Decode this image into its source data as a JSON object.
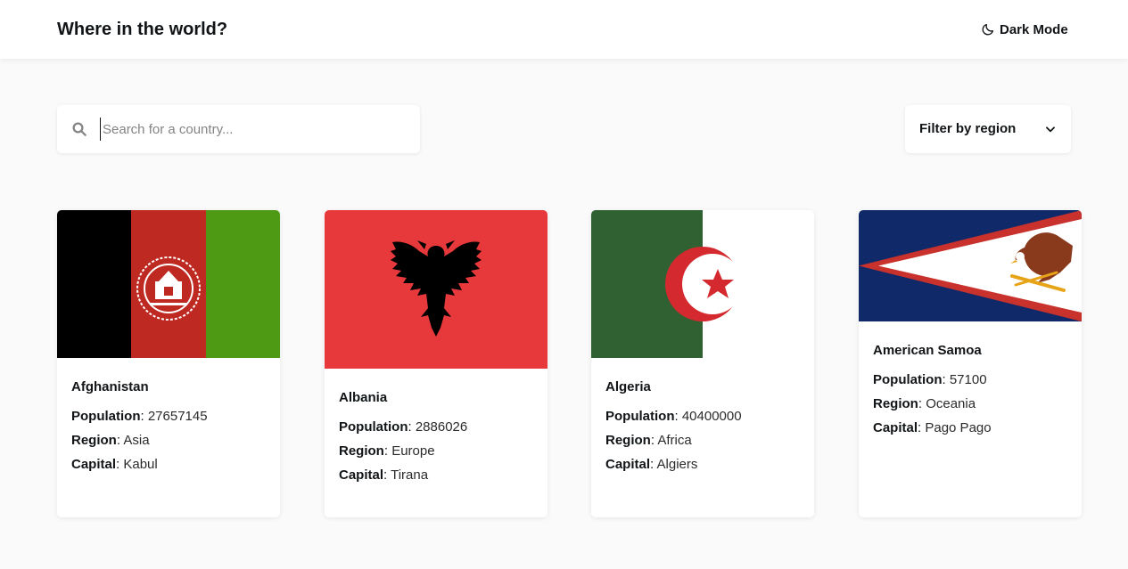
{
  "header": {
    "title": "Where in the world?",
    "dark_mode_label": "Dark Mode"
  },
  "search": {
    "placeholder": "Search for a country...",
    "value": ""
  },
  "filter": {
    "label": "Filter by region"
  },
  "field_labels": {
    "population": "Population",
    "region": "Region",
    "capital": "Capital"
  },
  "countries": [
    {
      "name": "Afghanistan",
      "population": "27657145",
      "region": "Asia",
      "capital": "Kabul",
      "flag_icon": "afghanistan-flag"
    },
    {
      "name": "Albania",
      "population": "2886026",
      "region": "Europe",
      "capital": "Tirana",
      "flag_icon": "albania-flag"
    },
    {
      "name": "Algeria",
      "population": "40400000",
      "region": "Africa",
      "capital": "Algiers",
      "flag_icon": "algeria-flag"
    },
    {
      "name": "American Samoa",
      "population": "57100",
      "region": "Oceania",
      "capital": "Pago Pago",
      "flag_icon": "american-samoa-flag"
    }
  ],
  "colors": {
    "background": "#fafafa",
    "element": "#ffffff",
    "text": "#111517",
    "placeholder": "#848484"
  }
}
